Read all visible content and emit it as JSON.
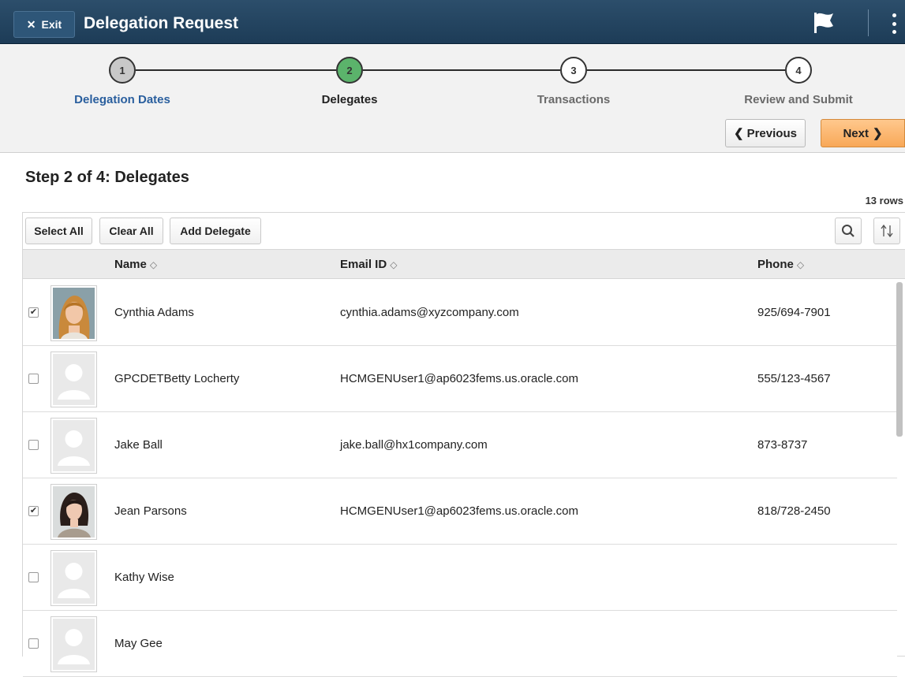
{
  "header": {
    "exit_label": "Exit",
    "title": "Delegation Request"
  },
  "train": {
    "steps": [
      {
        "number": "1",
        "label": "Delegation Dates",
        "state": "visited"
      },
      {
        "number": "2",
        "label": "Delegates",
        "state": "current"
      },
      {
        "number": "3",
        "label": "Transactions",
        "state": "future"
      },
      {
        "number": "4",
        "label": "Review and Submit",
        "state": "future"
      }
    ],
    "previous_label": "Previous",
    "next_label": "Next"
  },
  "content": {
    "step_title": "Step 2 of 4: Delegates",
    "rows_count": "13 rows"
  },
  "toolbar": {
    "select_all": "Select All",
    "clear_all": "Clear All",
    "add_delegate": "Add Delegate"
  },
  "columns": {
    "name": "Name",
    "email": "Email ID",
    "phone": "Phone"
  },
  "rows": [
    {
      "name": "Cynthia Adams",
      "email": "cynthia.adams@xyzcompany.com",
      "phone": "925/694-7901",
      "checked": true,
      "photo": "photo-woman-blonde"
    },
    {
      "name": "GPCDETBetty Locherty",
      "email": "HCMGENUser1@ap6023fems.us.oracle.com",
      "phone": "555/123-4567",
      "checked": false,
      "photo": "placeholder"
    },
    {
      "name": "Jake Ball",
      "email": "jake.ball@hx1company.com",
      "phone": "873-8737",
      "checked": false,
      "photo": "placeholder"
    },
    {
      "name": "Jean Parsons",
      "email": "HCMGENUser1@ap6023fems.us.oracle.com",
      "phone": "818/728-2450",
      "checked": true,
      "photo": "photo-woman-dark-hair"
    },
    {
      "name": "Kathy Wise",
      "email": "",
      "phone": "",
      "checked": false,
      "photo": "placeholder"
    },
    {
      "name": "May Gee",
      "email": "",
      "phone": "",
      "checked": false,
      "photo": "placeholder"
    }
  ],
  "colors": {
    "header_bg": "#1d3c57",
    "current_step": "#5bb36b",
    "visited_step": "#c8c8c8",
    "next_button": "#f8a858",
    "link_blue": "#2a5f9e"
  }
}
